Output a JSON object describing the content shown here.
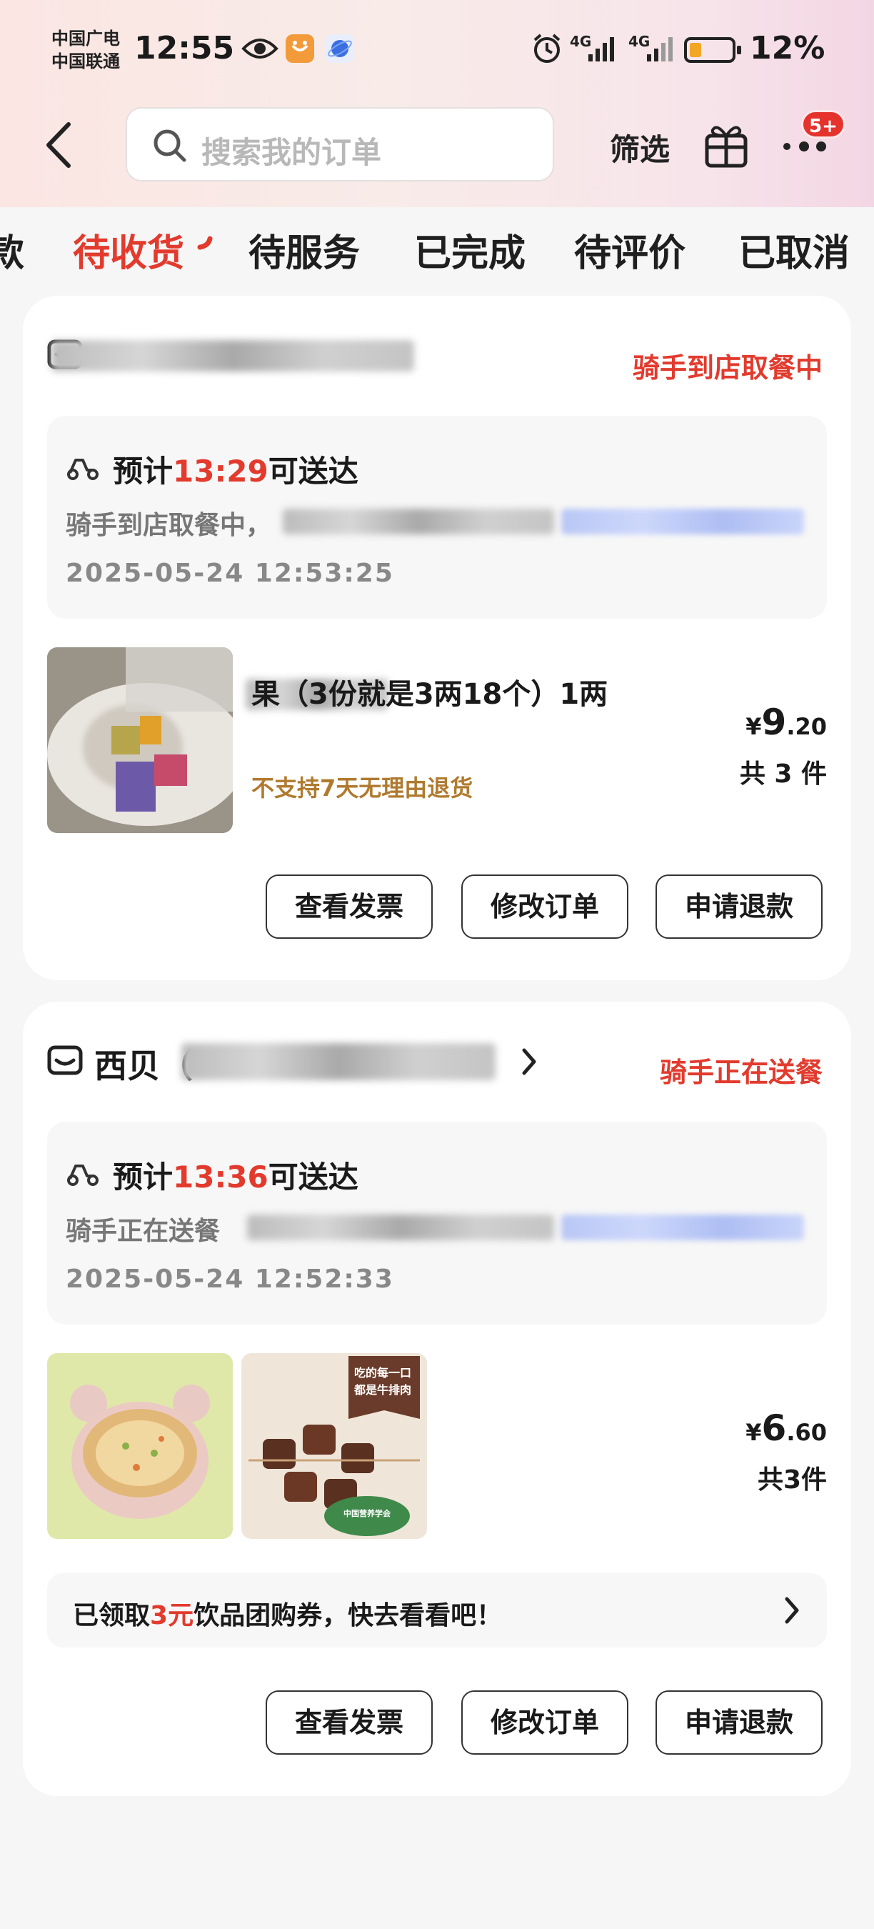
{
  "status_bar": {
    "carrier_line1": "中国广电",
    "carrier_line2": "中国联通",
    "time": "12:55",
    "net1": "4G",
    "net2": "4G",
    "battery_percent": "12%",
    "battery_level": 0.12
  },
  "header": {
    "search_placeholder": "搜索我的订单",
    "filter_label": "筛选",
    "message_badge": "5+"
  },
  "tabs": [
    {
      "label": "款",
      "active": false
    },
    {
      "label": "待收货",
      "active": true
    },
    {
      "label": "待服务",
      "active": false
    },
    {
      "label": "已完成",
      "active": false
    },
    {
      "label": "待评价",
      "active": false
    },
    {
      "label": "已取消",
      "active": false
    }
  ],
  "orders": [
    {
      "shop_name": "",
      "status": "骑手到店取餐中",
      "eta_prefix": "预计",
      "eta_time": "13:29",
      "eta_suffix": "可送达",
      "rider_text": "骑手到店取餐中，",
      "timestamp": "2025-05-24  12:53:25",
      "product_title": "果（3份就是3两18个）1两",
      "product_note": "不支持7天无理由退货",
      "price_symbol": "¥",
      "price_int": "9",
      "price_dec": ".20",
      "count": "共 3 件",
      "buttons": [
        "查看发票",
        "修改订单",
        "申请退款"
      ]
    },
    {
      "shop_name": "西贝（",
      "status": "骑手正在送餐",
      "eta_prefix": "预计",
      "eta_time": "13:36",
      "eta_suffix": "可送达",
      "rider_text": "骑手正在送餐",
      "timestamp": "2025-05-24  12:52:33",
      "thumb2_text1": "吃的每一口",
      "thumb2_text2": "都是牛排肉",
      "thumb2_seal": "中国营养学会",
      "price_symbol": "¥",
      "price_int": "6",
      "price_dec": ".60",
      "count": "共3件",
      "coupon_prefix": "已领取",
      "coupon_amount": "3元",
      "coupon_suffix": "饮品团购券，快去看看吧！",
      "buttons": [
        "查看发票",
        "修改订单",
        "申请退款"
      ]
    }
  ],
  "colors": {
    "accent_red": "#e23b2e",
    "note_brown": "#b07a2e",
    "page_bg": "#f6f6f6"
  },
  "icons": [
    "back-arrow-icon",
    "search-icon",
    "gift-icon",
    "more-dots-icon",
    "shop-icon",
    "scooter-icon",
    "chevron-right-icon",
    "alarm-icon",
    "eye-icon"
  ]
}
